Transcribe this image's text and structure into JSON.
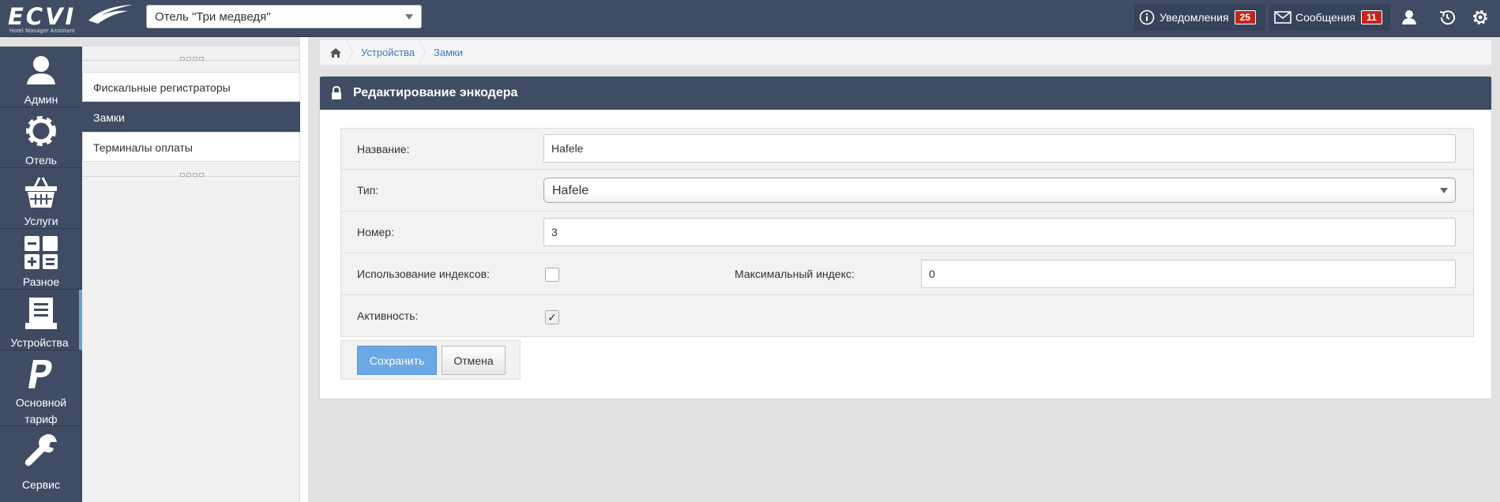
{
  "header": {
    "logo_text": "ECVI",
    "logo_subtitle": "Hotel Manager Assistant",
    "hotel_selected": "Отель \"Три медведя\"",
    "notifications": {
      "label": "Уведомления",
      "count": "25"
    },
    "messages": {
      "label": "Сообщения",
      "count": "11"
    },
    "icons": [
      "info-icon",
      "envelope-icon",
      "user-icon",
      "history-icon",
      "gear-icon"
    ]
  },
  "sidebar": {
    "items": [
      {
        "label": "Админ",
        "icon": "user-icon"
      },
      {
        "label": "Отель",
        "icon": "gear-icon"
      },
      {
        "label": "Услуги",
        "icon": "basket-icon"
      },
      {
        "label": "Разное",
        "icon": "calculator-icon"
      },
      {
        "label": "Устройства",
        "icon": "device-icon",
        "active": true
      },
      {
        "label_line1": "Основной",
        "label_line2": "тариф",
        "icon": "paypal-icon"
      },
      {
        "label": "Сервис",
        "icon": "wrench-icon"
      }
    ]
  },
  "submenu": {
    "items": [
      {
        "label": "Фискальные регистраторы"
      },
      {
        "label": "Замки",
        "active": true
      },
      {
        "label": "Терминалы оплаты"
      }
    ]
  },
  "breadcrumb": {
    "home_icon": "home-icon",
    "items": [
      "Устройства",
      "Замки"
    ]
  },
  "panel": {
    "title": "Редактирование энкодера",
    "title_icon": "lock-icon",
    "fields": {
      "name": {
        "label": "Название:",
        "value": "Hafele"
      },
      "type": {
        "label": "Тип:",
        "value": "Hafele"
      },
      "number": {
        "label": "Номер:",
        "value": "3"
      },
      "use_indexes": {
        "label": "Использование индексов:",
        "checked": false
      },
      "max_index": {
        "label": "Максимальный индекс:",
        "value": "0"
      },
      "active": {
        "label": "Активность:",
        "checked": true,
        "check_glyph": "✓"
      }
    },
    "buttons": {
      "save": "Сохранить",
      "cancel": "Отмена"
    }
  },
  "colors": {
    "navy": "#3f4c63",
    "badge_red": "#c0271c",
    "save_blue": "#6aa8e6",
    "link_blue": "#3a7bc0"
  }
}
